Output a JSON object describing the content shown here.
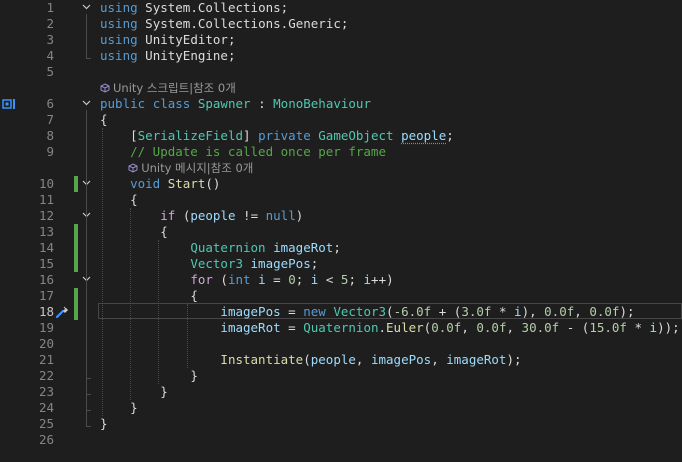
{
  "editor": {
    "codelens": [
      {
        "after_line": 5,
        "text": "Unity 스크립트|참조 0개"
      },
      {
        "after_line": 9,
        "text": "Unity 메시지|참조 0개"
      }
    ],
    "current_line": 18,
    "lines": [
      {
        "n": "1",
        "text": "using System.Collections;"
      },
      {
        "n": "2",
        "text": "using System.Collections.Generic;"
      },
      {
        "n": "3",
        "text": "using UnityEditor;"
      },
      {
        "n": "4",
        "text": "using UnityEngine;"
      },
      {
        "n": "5",
        "text": ""
      },
      {
        "n": "6",
        "text": "public class Spawner : MonoBehaviour"
      },
      {
        "n": "7",
        "text": "{"
      },
      {
        "n": "8",
        "text": "    [SerializeField] private GameObject people;"
      },
      {
        "n": "9",
        "text": "    // Update is called once per frame"
      },
      {
        "n": "10",
        "text": "    void Start()"
      },
      {
        "n": "11",
        "text": "    {"
      },
      {
        "n": "12",
        "text": "        if (people != null)"
      },
      {
        "n": "13",
        "text": "        {"
      },
      {
        "n": "14",
        "text": "            Quaternion imageRot;"
      },
      {
        "n": "15",
        "text": "            Vector3 imagePos;"
      },
      {
        "n": "16",
        "text": "            for (int i = 0; i < 5; i++)"
      },
      {
        "n": "17",
        "text": "            {"
      },
      {
        "n": "18",
        "text": "                imagePos = new Vector3(-6.0f + (3.0f * i), 0.0f, 0.0f);"
      },
      {
        "n": "19",
        "text": "                imageRot = Quaternion.Euler(0.0f, 0.0f, 30.0f - (15.0f * i));"
      },
      {
        "n": "20",
        "text": ""
      },
      {
        "n": "21",
        "text": "                Instantiate(people, imagePos, imageRot);"
      },
      {
        "n": "22",
        "text": "            }"
      },
      {
        "n": "23",
        "text": "        }"
      },
      {
        "n": "24",
        "text": "    }"
      },
      {
        "n": "25",
        "text": "}"
      },
      {
        "n": "26",
        "text": ""
      }
    ],
    "changed_lines": [
      10,
      13,
      14,
      15,
      17,
      18
    ],
    "fold_lines": [
      1,
      6,
      10,
      12,
      16
    ],
    "colors": {
      "keyword": "#569cd6",
      "keyword_control": "#d8a0df",
      "type": "#4ec9b0",
      "comment": "#57a64a",
      "number": "#b5cea8",
      "method": "#dcdcaa",
      "variable": "#9cdcfe",
      "local": "#9cdcfe",
      "text": "#dcdcdc",
      "change_bar": "#57a64a"
    }
  }
}
